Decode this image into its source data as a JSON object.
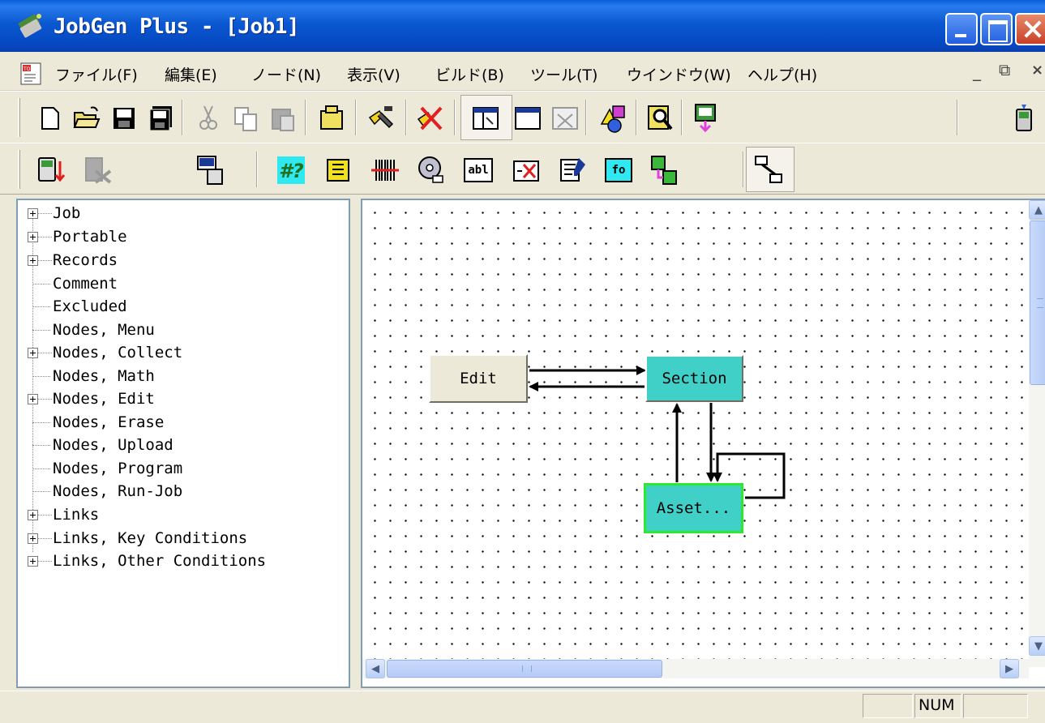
{
  "window": {
    "title": "JobGen Plus - [Job1]"
  },
  "menu": {
    "items": [
      "ファイル(F)",
      "編集(E)",
      "ノード(N)",
      "表示(V)",
      "ビルド(B)",
      "ツール(T)",
      "ウインドウ(W)",
      "ヘルプ(H)"
    ]
  },
  "mdi_controls": {
    "minimize": "_",
    "restore": "⧉",
    "close": "×"
  },
  "toolbar1": {
    "icons": [
      "new-document-icon",
      "open-folder-icon",
      "save-icon",
      "save-all-icon",
      "cut-icon",
      "copy-icon",
      "paste-icon",
      "properties-icon",
      "build-tools-icon",
      "clear-build-icon",
      "tree-view-icon",
      "window-icon",
      "close-window-icon",
      "shapes-icon",
      "find-icon",
      "download-icon",
      "handheld-icon"
    ]
  },
  "toolbar2": {
    "icons": [
      "handheld-download-icon",
      "disabled-tool-icon",
      "connect-device-icon",
      "question-node-icon",
      "menu-node-icon",
      "barcode-node-icon",
      "cd-node-icon",
      "abl-field-icon",
      "error-node-icon",
      "edit-node-icon",
      "fo-node-icon",
      "tree-node-icon",
      "link-tool-icon"
    ],
    "labels": {
      "abl": "abl",
      "fo": "fo"
    }
  },
  "tree": {
    "items": [
      {
        "label": "Job",
        "expandable": true
      },
      {
        "label": "Portable",
        "expandable": true
      },
      {
        "label": "Records",
        "expandable": true
      },
      {
        "label": "Comment",
        "expandable": false
      },
      {
        "label": "Excluded",
        "expandable": false
      },
      {
        "label": "Nodes, Menu",
        "expandable": false
      },
      {
        "label": "Nodes, Collect",
        "expandable": true
      },
      {
        "label": "Nodes, Math",
        "expandable": false
      },
      {
        "label": "Nodes, Edit",
        "expandable": true
      },
      {
        "label": "Nodes, Erase",
        "expandable": false
      },
      {
        "label": "Nodes, Upload",
        "expandable": false
      },
      {
        "label": "Nodes, Program",
        "expandable": false
      },
      {
        "label": "Nodes, Run-Job",
        "expandable": false
      },
      {
        "label": "Links",
        "expandable": true
      },
      {
        "label": "Links, Key Conditions",
        "expandable": true
      },
      {
        "label": "Links, Other Conditions",
        "expandable": true
      }
    ]
  },
  "canvas": {
    "nodes": {
      "edit": "Edit",
      "section": "Section",
      "asset": "Asset..."
    }
  },
  "scrollbars": {
    "up": "▲",
    "down": "▼",
    "left": "◀",
    "right": "▶"
  },
  "statusbar": {
    "pane1": "",
    "num": "NUM",
    "pane3": ""
  },
  "colors": {
    "title_blue": "#0a58d0",
    "node_cyan": "#40d0c8",
    "selected_border": "#2ee82e",
    "window_face": "#ece9d8"
  }
}
